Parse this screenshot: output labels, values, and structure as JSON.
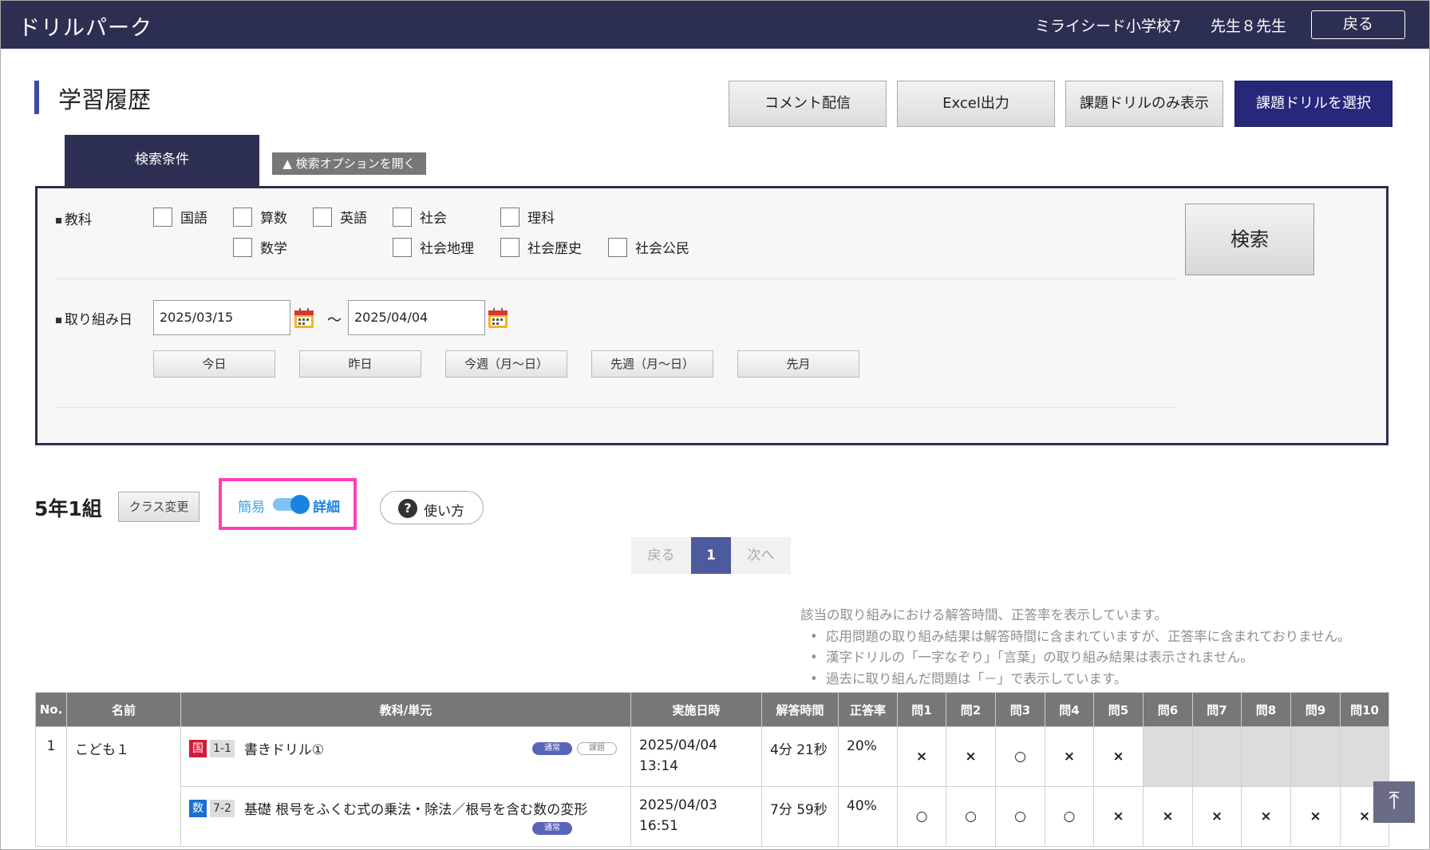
{
  "header": {
    "app_title": "ドリルパーク",
    "school": "ミライシード小学校7",
    "teacher": "先生８先生",
    "back_label": "戻る"
  },
  "page": {
    "title": "学習履歴"
  },
  "toolbar": {
    "comment_label": "コメント配信",
    "excel_label": "Excel出力",
    "kadai_only_label": "課題ドリルのみ表示",
    "kadai_select_label": "課題ドリルを選択"
  },
  "search": {
    "tab_label": "検索条件",
    "option_label": "▲ 検索オプションを開く",
    "subject_label": "教科",
    "date_label": "取り組み日",
    "subjects": [
      "国語",
      "算数",
      "英語",
      "社会",
      "理科",
      "数学",
      "社会地理",
      "社会歴史",
      "社会公民"
    ],
    "date_from": "2025/03/15",
    "date_to": "2025/04/04",
    "tilde": "～",
    "quick": [
      "今日",
      "昨日",
      "今週（月～日）",
      "先週（月～日）",
      "先月"
    ],
    "search_label": "検索"
  },
  "class_bar": {
    "class_name": "5年1組",
    "class_change_label": "クラス変更",
    "toggle_simple": "簡易",
    "toggle_detail": "詳細",
    "usage_label": "使い方",
    "usage_icon": "?"
  },
  "pagination": {
    "prev": "戻る",
    "current": "1",
    "next": "次へ"
  },
  "notes": {
    "main": "該当の取り組みにおける解答時間、正答率を表示しています。",
    "items": [
      "応用問題の取り組み結果は解答時間に含まれていますが、正答率に含まれておりません。",
      "漢字ドリルの「一字なぞり」「言葉」の取り組み結果は表示されません。",
      "過去に取り組んだ問題は「－」で表示しています。"
    ]
  },
  "table": {
    "headers": [
      "No.",
      "名前",
      "教科/単元",
      "実施日時",
      "解答時間",
      "正答率",
      "問1",
      "問2",
      "問3",
      "問4",
      "問5",
      "問6",
      "問7",
      "問8",
      "問9",
      "問10"
    ],
    "rows": [
      {
        "no": "1",
        "name": "こども１",
        "subject_badge": "国",
        "unit_code": "1-1",
        "unit_name": "書きドリル①",
        "tags": [
          "通常",
          "課題"
        ],
        "date": "2025/04/04",
        "time": "13:14",
        "answer_time": "4分 21秒",
        "rate": "20%",
        "marks": [
          "×",
          "×",
          "○",
          "×",
          "×",
          "",
          "",
          "",
          "",
          ""
        ]
      },
      {
        "no": "",
        "name": "",
        "subject_badge": "数",
        "unit_code": "7-2",
        "unit_name": "基礎 根号をふくむ式の乗法・除法／根号を含む数の変形",
        "tags": [
          "通常"
        ],
        "date": "2025/04/03",
        "time": "16:51",
        "answer_time": "7分 59秒",
        "rate": "40%",
        "marks": [
          "○",
          "○",
          "○",
          "○",
          "×",
          "×",
          "×",
          "×",
          "×",
          "×"
        ]
      }
    ]
  },
  "scroll_top_icon": "arrow-up-to-top-icon",
  "colors": {
    "header_bg": "#2d2f52",
    "primary_button": "#27287a",
    "accent_blue": "#1a82e0",
    "highlight_pink": "#ff3fbf",
    "mark_x": "#e02020"
  }
}
